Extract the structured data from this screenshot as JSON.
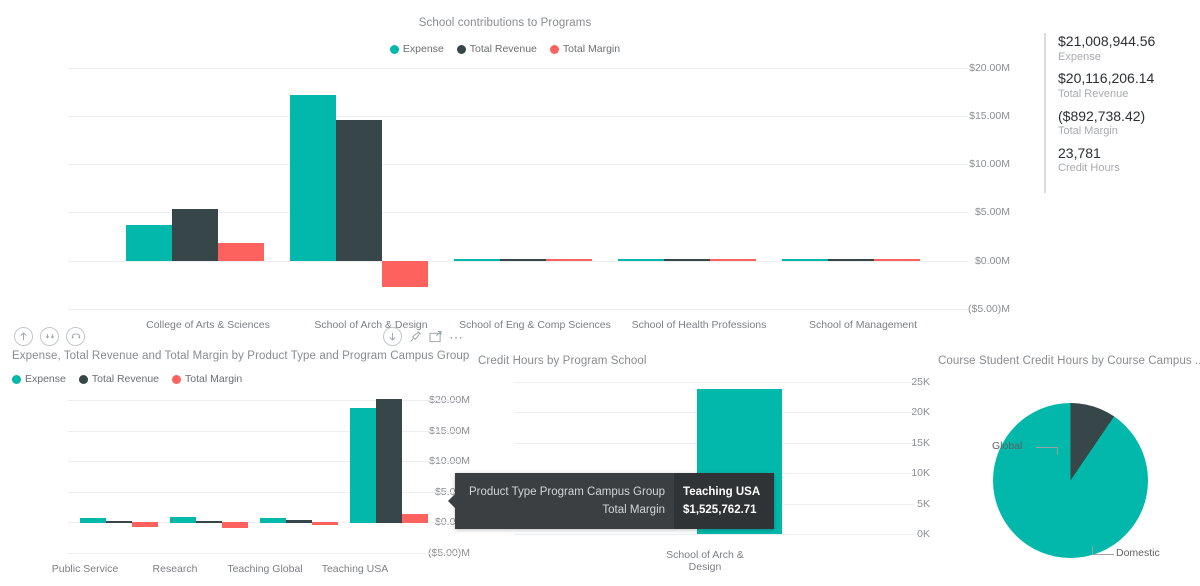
{
  "colors": {
    "expense": "#01B8AA",
    "total_revenue": "#374649",
    "total_margin": "#FD625E",
    "grid": "#eceef0",
    "axis_text": "#8a8e91",
    "title_text": "#888c8f"
  },
  "kpi": {
    "items": [
      {
        "value": "$21,008,944.56",
        "label": "Expense"
      },
      {
        "value": "$20,116,206.14",
        "label": "Total Revenue"
      },
      {
        "value": "($892,738.42)",
        "label": "Total Margin"
      },
      {
        "value": "23,781",
        "label": "Credit Hours"
      }
    ]
  },
  "icons": {
    "drill_up": "drill-up-icon",
    "expand_next_level": "expand-next-level-icon",
    "drill_down_hierarchy": "drill-down-hierarchy-icon",
    "drill_down": "drill-down-icon",
    "pin": "pin-visual-icon",
    "focus": "focus-mode-icon",
    "more": "more-options-icon"
  },
  "tooltip": {
    "rows": [
      {
        "key": "Product Type Program Campus Group",
        "value": "Teaching USA"
      },
      {
        "key": "Total Margin",
        "value": "$1,525,762.71"
      }
    ]
  },
  "chart_data": [
    {
      "id": "school_contributions",
      "type": "bar",
      "title": "School contributions to Programs",
      "xlabel": "",
      "ylabel": "",
      "ylim": [
        -5000000,
        20000000
      ],
      "ytick_labels": [
        "$20.00M",
        "$15.00M",
        "$10.00M",
        "$5.00M",
        "$0.00M",
        "($5.00)M"
      ],
      "ytick_values": [
        20000000,
        15000000,
        10000000,
        5000000,
        0,
        -5000000
      ],
      "grid": true,
      "legend": [
        "Expense",
        "Total Revenue",
        "Total Margin"
      ],
      "legend_position": "top",
      "categories": [
        "College of Arts & Sciences",
        "School of Arch & Design",
        "School of Eng & Comp Sciences",
        "School of Health Professions",
        "School of Management"
      ],
      "series": [
        {
          "name": "Expense",
          "values": [
            3700000,
            17200000,
            30000,
            30000,
            30000
          ]
        },
        {
          "name": "Total Revenue",
          "values": [
            5400000,
            14600000,
            25000,
            25000,
            25000
          ]
        },
        {
          "name": "Total Margin",
          "values": [
            1880000,
            -2620000,
            20000,
            20000,
            20000
          ]
        }
      ]
    },
    {
      "id": "product_type_campus_group",
      "type": "bar",
      "title": "Expense, Total Revenue and Total Margin by Product Type and Program Campus Group",
      "xlabel": "",
      "ylabel": "",
      "ylim": [
        -5000000,
        20000000
      ],
      "ytick_labels": [
        "$20.00M",
        "$15.00M",
        "$10.00M",
        "$5.00M",
        "$0.00M",
        "($5.00)M"
      ],
      "ytick_values": [
        20000000,
        15000000,
        10000000,
        5000000,
        0,
        -5000000
      ],
      "grid": true,
      "legend": [
        "Expense",
        "Total Revenue",
        "Total Margin"
      ],
      "legend_position": "top",
      "categories": [
        "Public Service",
        "Research",
        "Teaching Global",
        "Teaching USA"
      ],
      "series": [
        {
          "name": "Expense",
          "values": [
            720000,
            880000,
            760000,
            18700000
          ]
        },
        {
          "name": "Total Revenue",
          "values": [
            80000,
            60000,
            420000,
            20200000
          ]
        },
        {
          "name": "Total Margin",
          "values": [
            -640000,
            -820000,
            -340000,
            1525762.71
          ]
        }
      ]
    },
    {
      "id": "credit_hours_by_program_school",
      "type": "bar",
      "title": "Credit Hours by Program School",
      "xlabel": "",
      "ylabel": "",
      "ylim": [
        0,
        25000
      ],
      "ytick_labels": [
        "25K",
        "20K",
        "15K",
        "10K",
        "5K",
        "0K"
      ],
      "ytick_values": [
        25000,
        20000,
        15000,
        10000,
        5000,
        0
      ],
      "grid": true,
      "categories": [
        "School of Arch & Design"
      ],
      "values": [
        23781
      ]
    },
    {
      "id": "course_student_credit_hours",
      "type": "pie",
      "title": "Course Student Credit Hours by Course Campus ...",
      "labels": [
        "Domestic",
        "Global"
      ],
      "values": [
        90.5,
        9.5
      ],
      "colors": [
        "#01B8AA",
        "#374649"
      ],
      "legend_position": "callout-labels"
    }
  ]
}
